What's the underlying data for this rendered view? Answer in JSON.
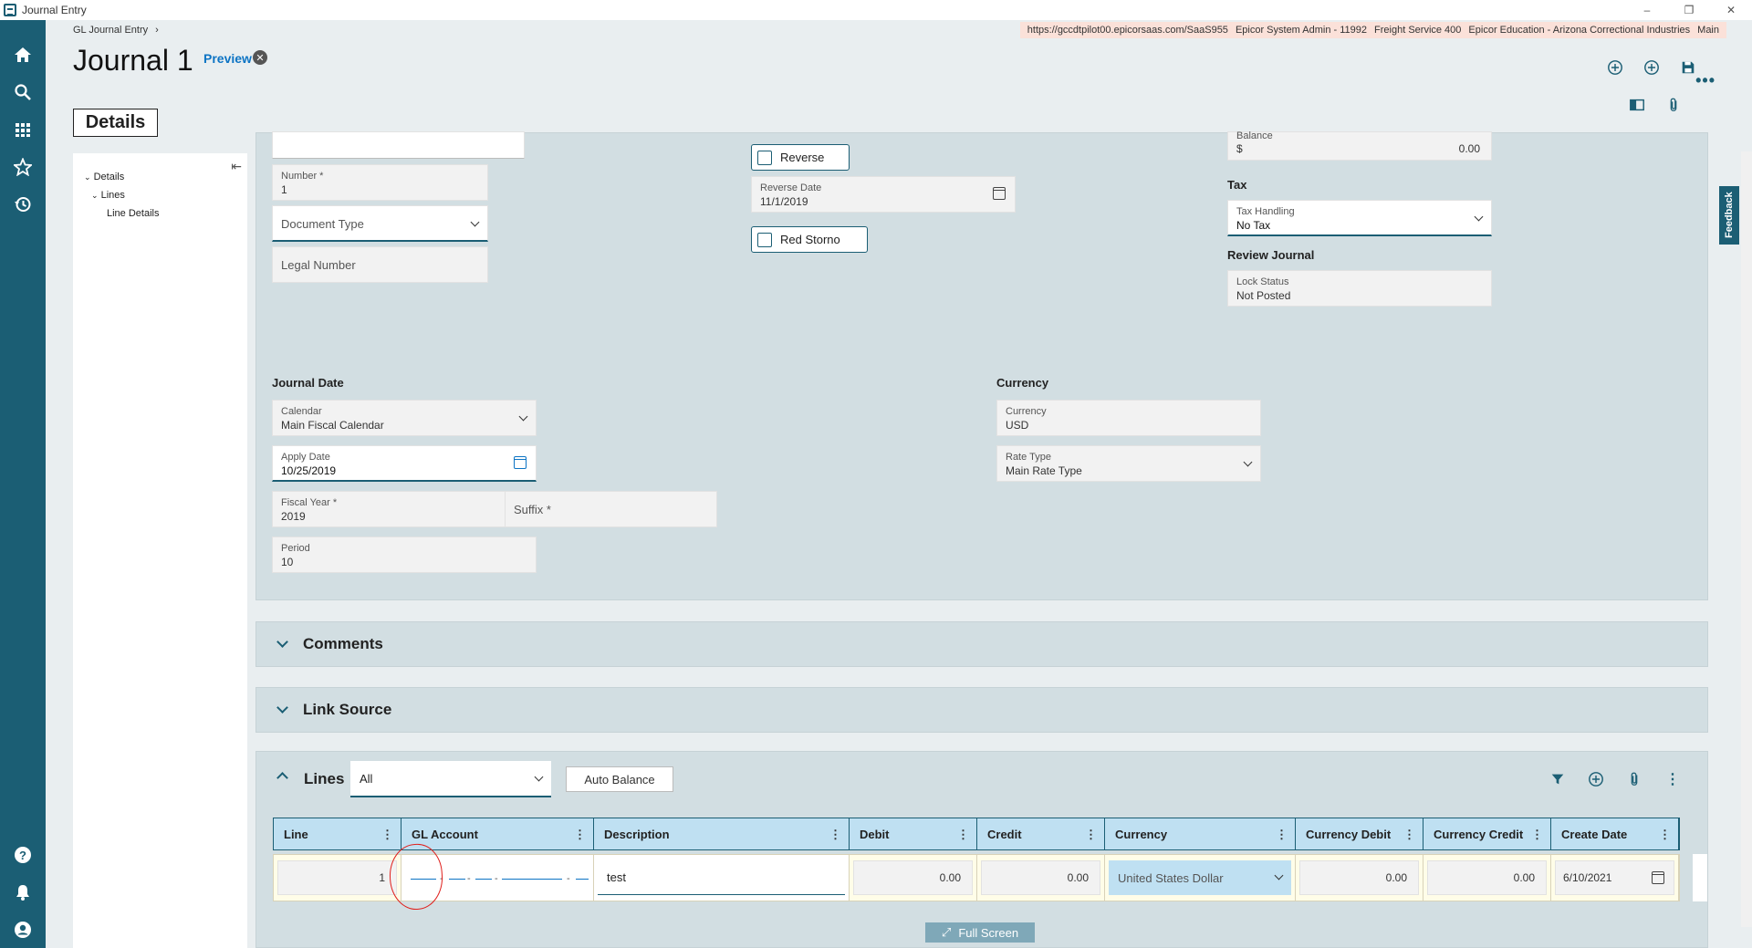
{
  "window": {
    "title": "Journal Entry",
    "controls": [
      "–",
      "❐",
      "✕"
    ]
  },
  "breadcrumb": {
    "root": "GL Journal Entry",
    "separator": "›"
  },
  "context": {
    "url": "https://gccdtpilot00.epicorsaas.com/SaaS955",
    "user": "Epicor System Admin - 11992",
    "service": "Freight Service 400",
    "company": "Epicor Education - Arizona Correctional Industries",
    "site": "Main"
  },
  "page": {
    "title": "Journal 1",
    "preview_label": "Preview"
  },
  "tabs": {
    "details": "Details"
  },
  "tree": {
    "details": "Details",
    "lines": "Lines",
    "line_details": "Line Details"
  },
  "form": {
    "number": {
      "label": "Number *",
      "value": "1"
    },
    "document_type": {
      "placeholder": "Document Type"
    },
    "legal_number": {
      "placeholder": "Legal Number"
    },
    "reverse_label": "Reverse",
    "reverse_date": {
      "label": "Reverse Date",
      "value": "11/1/2019"
    },
    "red_storno_label": "Red Storno",
    "balance": {
      "label": "Balance",
      "symbol": "$",
      "value": "0.00"
    },
    "tax_section": "Tax",
    "tax_handling": {
      "label": "Tax Handling",
      "value": "No Tax"
    },
    "review_section": "Review Journal",
    "lock_status": {
      "label": "Lock Status",
      "value": "Not Posted"
    },
    "journal_date_section": "Journal Date",
    "calendar": {
      "label": "Calendar",
      "value": "Main Fiscal Calendar"
    },
    "apply_date": {
      "label": "Apply Date",
      "value": "10/25/2019"
    },
    "fiscal_year": {
      "label": "Fiscal Year *",
      "value": "2019"
    },
    "suffix": {
      "placeholder": "Suffix *"
    },
    "period": {
      "label": "Period",
      "value": "10"
    },
    "currency_section": "Currency",
    "currency": {
      "label": "Currency",
      "value": "USD"
    },
    "rate_type": {
      "label": "Rate Type",
      "value": "Main Rate Type"
    }
  },
  "panels": {
    "comments": "Comments",
    "link_source": "Link Source",
    "lines": "Lines"
  },
  "lines": {
    "filter_value": "All",
    "auto_balance": "Auto Balance",
    "columns": [
      "Line",
      "GL Account",
      "Description",
      "Debit",
      "Credit",
      "Currency",
      "Currency Debit",
      "Currency Credit",
      "Create Date"
    ],
    "row": {
      "line": "1",
      "description": "test",
      "debit": "0.00",
      "credit": "0.00",
      "currency": "United States Dollar",
      "currency_debit": "0.00",
      "currency_credit": "0.00",
      "create_date": "6/10/2021"
    },
    "full_screen": "Full Screen"
  },
  "feedback": "Feedback",
  "icons": {
    "rail": [
      "home-icon",
      "search-icon",
      "apps-grid-icon",
      "star-icon",
      "history-icon",
      "help-icon",
      "bell-icon",
      "user-icon"
    ],
    "accent": "#1b5e74",
    "link": "#0d74c4"
  }
}
